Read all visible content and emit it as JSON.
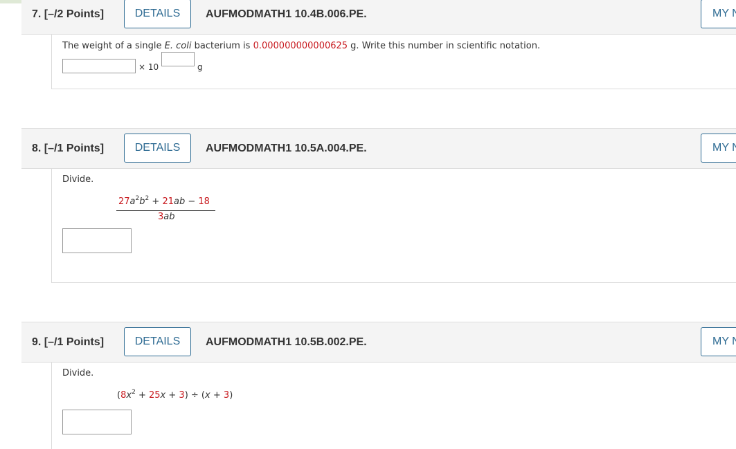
{
  "questions": [
    {
      "number": "7.",
      "points": "[–/2 Points]",
      "details_label": "DETAILS",
      "code": "AUFMODMATH1 10.4B.006.PE.",
      "mynotes_label": "MY NOTES",
      "prompt_before": "The weight of a single ",
      "prompt_italic": "E. coli",
      "prompt_mid": " bacterium is ",
      "prompt_value": "0.000000000000625",
      "prompt_after": " g. Write this number in scientific notation.",
      "times_ten": "× 10",
      "unit": "g",
      "mantissa_value": "",
      "exponent_value": ""
    },
    {
      "number": "8.",
      "points": "[–/1 Points]",
      "details_label": "DETAILS",
      "code": "AUFMODMATH1 10.5A.004.PE.",
      "mynotes_label": "MY NOTES",
      "prompt": "Divide.",
      "num_coef1": "27",
      "num_var1a": "a",
      "num_exp1a": "2",
      "num_var1b": "b",
      "num_exp1b": "2",
      "num_op1": "+",
      "num_coef2": "21",
      "num_var2": "ab",
      "num_op2": "−",
      "num_const": "18",
      "den_coef": "3",
      "den_var": "ab",
      "answer_value": ""
    },
    {
      "number": "9.",
      "points": "[–/1 Points]",
      "details_label": "DETAILS",
      "code": "AUFMODMATH1 10.5B.002.PE.",
      "mynotes_label": "MY NOTES",
      "prompt": "Divide.",
      "open_paren": "(",
      "coef1": "8",
      "var1": "x",
      "exp1": "2",
      "op1": "+",
      "coef2": "25",
      "var2": "x",
      "op2": "+",
      "const1": "3",
      "close_div": ") ÷ (",
      "var3": "x",
      "op3": "+",
      "const2": "3",
      "close_paren": ")",
      "answer_value": ""
    }
  ]
}
